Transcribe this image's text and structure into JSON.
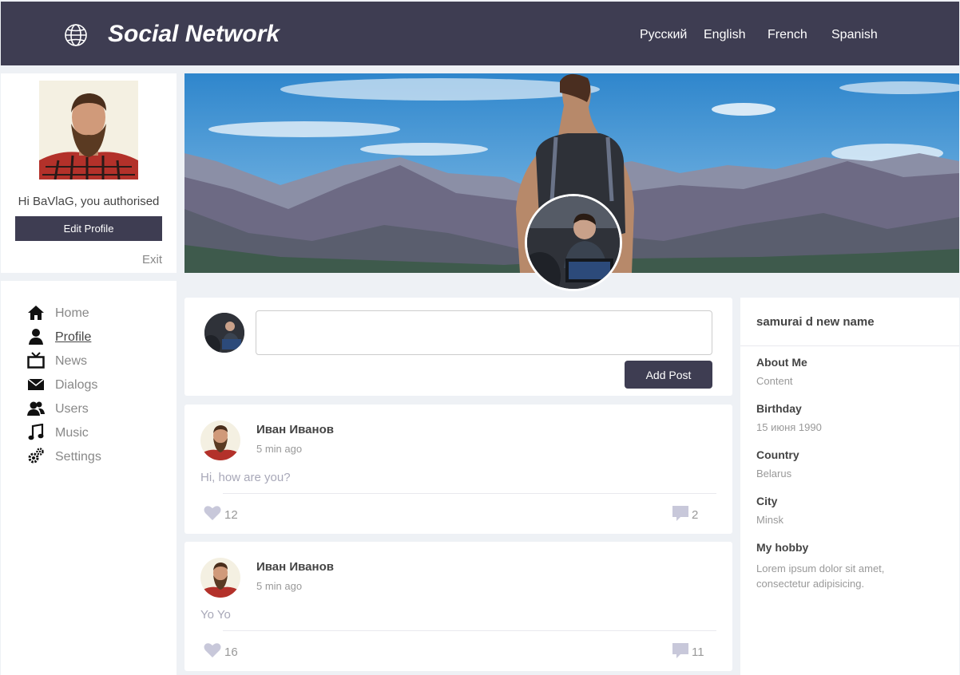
{
  "header": {
    "title": "Social Network",
    "languages": [
      "Русский",
      "English",
      "French",
      "Spanish"
    ]
  },
  "profile": {
    "greeting": "Hi BaVlaG, you authorised",
    "edit_label": "Edit Profile",
    "exit_label": "Exit"
  },
  "nav": {
    "items": [
      {
        "label": "Home",
        "icon": "home-icon"
      },
      {
        "label": "Profile",
        "icon": "user-icon",
        "active": true
      },
      {
        "label": "News",
        "icon": "tv-icon"
      },
      {
        "label": "Dialogs",
        "icon": "envelope-icon"
      },
      {
        "label": "Users",
        "icon": "users-icon"
      },
      {
        "label": "Music",
        "icon": "music-icon"
      },
      {
        "label": "Settings",
        "icon": "gears-icon"
      }
    ]
  },
  "post_form": {
    "value": "",
    "button_label": "Add Post"
  },
  "posts": [
    {
      "author": "Иван Иванов",
      "time": "5 min ago",
      "text": "Hi, how are you?",
      "likes": "12",
      "comments": "2"
    },
    {
      "author": "Иван Иванов",
      "time": "5 min ago",
      "text": "Yo Yo",
      "likes": "16",
      "comments": "11"
    }
  ],
  "info": {
    "name": "samurai d new name",
    "about_label": "About Me",
    "about_value": "Content",
    "birthday_label": "Birthday",
    "birthday_value": "15 июня 1990",
    "country_label": "Country",
    "country_value": "Belarus",
    "city_label": "City",
    "city_value": "Minsk",
    "hobby_label": "My hobby",
    "hobby_value": "Lorem ipsum dolor sit amet, consectetur adipisicing."
  },
  "colors": {
    "header_bg": "#3e3d52",
    "button_bg": "#3e3d52",
    "page_bg": "#eef1f5",
    "muted_text": "#999999",
    "icon_muted": "#c8c8da"
  }
}
